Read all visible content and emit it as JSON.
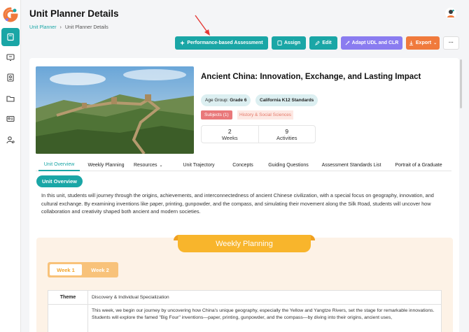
{
  "header": {
    "title": "Unit Planner Details",
    "breadcrumb": [
      "Unit Planner",
      "Unit Planner Details"
    ]
  },
  "sidebar": {
    "items": [
      {
        "icon": "book-icon",
        "active": true
      },
      {
        "icon": "monitor-icon",
        "active": false
      },
      {
        "icon": "portrait-card-icon",
        "active": false
      },
      {
        "icon": "folder-icon",
        "active": false
      },
      {
        "icon": "id-card-icon",
        "active": false
      },
      {
        "icon": "user-settings-icon",
        "active": false
      }
    ]
  },
  "toolbar": {
    "pba_label": "Performance-based Assessment",
    "assign_label": "Assign",
    "edit_label": "Edit",
    "adapt_label": "Adapt UDL and CLR",
    "export_label": "Export",
    "more_label": "···"
  },
  "unit": {
    "title": "Ancient China: Innovation, Exchange, and Lasting Impact",
    "age_group_label": "Age Group:",
    "age_group_value": "Grade 6",
    "standards": "California K12 Standards",
    "subjects_label": "Subjects (1)",
    "subject": "History & Social Sciences",
    "weeks_count": "2",
    "weeks_label": "Weeks",
    "activities_count": "9",
    "activities_label": "Activities"
  },
  "tabs": [
    "Unit Overview",
    "Weekly Planning",
    "Resources",
    "Unit Trajectory",
    "Concepts",
    "Guiding Questions",
    "Assessment Standards List",
    "Portrait of a Graduate"
  ],
  "overview": {
    "heading": "Unit Overview",
    "text": "In this unit, students will journey through the origins, achievements, and interconnectedness of ancient Chinese civilization, with a special focus on geography, innovation, and cultural exchange. By examining inventions like paper, printing, gunpowder, and the compass, and simulating their movement along the Silk Road, students will uncover how collaboration and creativity shaped both ancient and modern societies."
  },
  "weekly_planning": {
    "banner": "Weekly Planning",
    "weeks": [
      "Week 1",
      "Week 2"
    ],
    "rows": [
      {
        "key": "Theme",
        "value": "Discovery & Individual Specialization"
      },
      {
        "key": "",
        "value": "This week, we begin our journey by uncovering how China's unique geography, especially the Yellow and Yangtze Rivers, set the stage for remarkable innovations. Students will explore the famed \"Big Four\" inventions—paper, printing, gunpowder, and the compass—by diving into their origins, ancient uses,"
      }
    ]
  },
  "colors": {
    "accent": "#1aa6a6",
    "purple": "#8a7cf0",
    "orange": "#f07a3c",
    "banner": "#f8b52c"
  }
}
